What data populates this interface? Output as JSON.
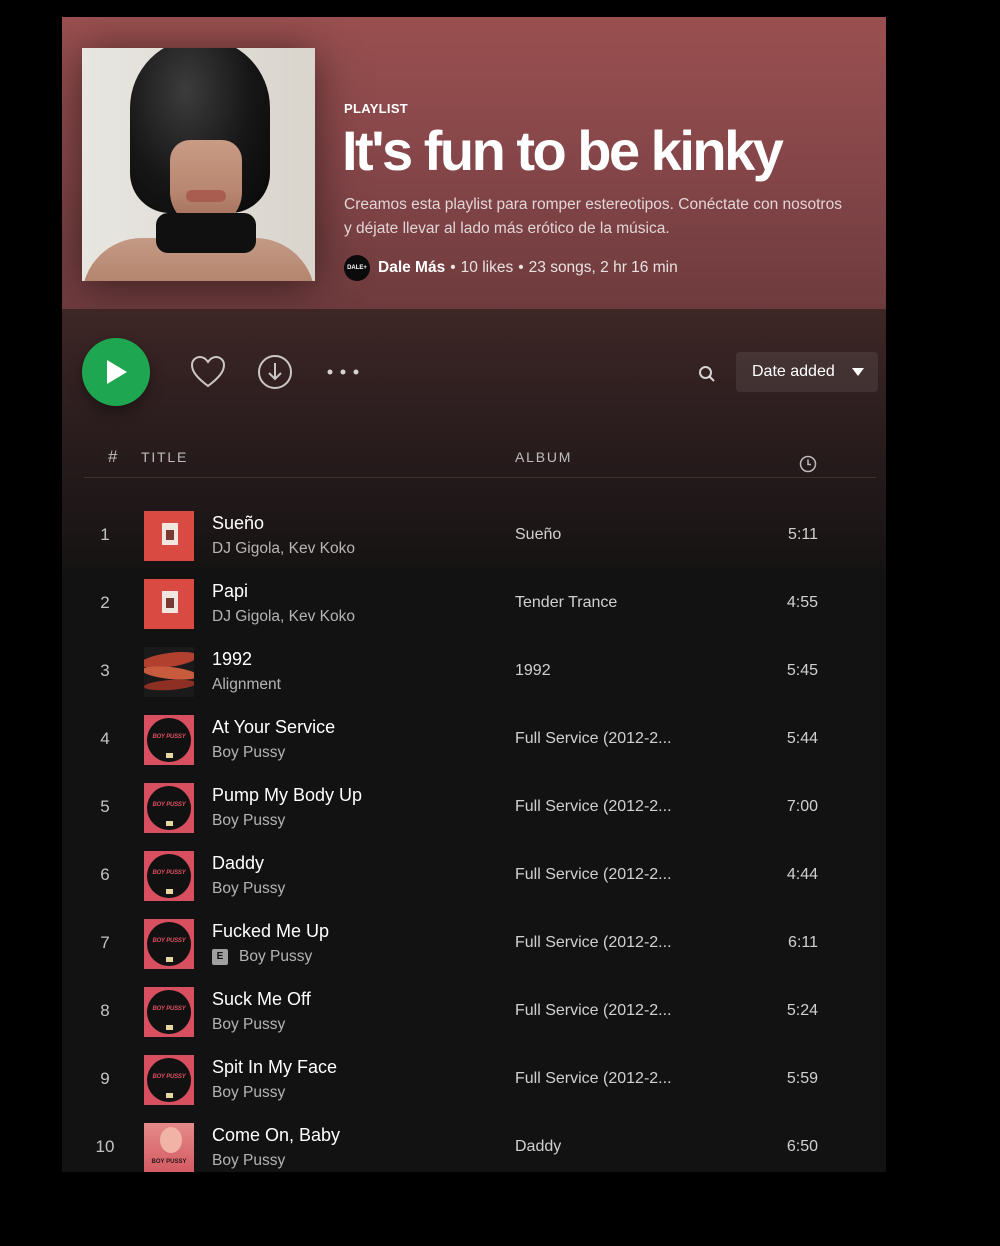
{
  "playlist": {
    "label": "PLAYLIST",
    "title": "It's fun to be kinky",
    "description": "Creamos esta playlist para romper estereotipos. Conéctate con nosotros y déjate llevar al lado más erótico de la música.",
    "owner": "Dale Más",
    "owner_avatar_text": "DALE+",
    "likes": "10 likes",
    "songs_duration": "23 songs, 2 hr 16 min",
    "separator": "•"
  },
  "controls": {
    "sort_label": "Date added",
    "icons": [
      "play-icon",
      "heart-icon",
      "download-icon",
      "more-icon",
      "search-icon",
      "caret-down-icon"
    ]
  },
  "table": {
    "headers": {
      "number": "#",
      "title": "TITLE",
      "album": "ALBUM",
      "duration_icon": "clock-icon"
    },
    "rows": [
      {
        "num": "1",
        "title": "Sueño",
        "artist": "DJ Gigola, Kev Koko",
        "album": "Sueño",
        "duration": "5:11",
        "explicit": false,
        "art": "red"
      },
      {
        "num": "2",
        "title": "Papi",
        "artist": "DJ Gigola, Kev Koko",
        "album": "Tender Trance",
        "duration": "4:55",
        "explicit": false,
        "art": "red"
      },
      {
        "num": "3",
        "title": "1992",
        "artist": "Alignment",
        "album": "1992",
        "duration": "5:45",
        "explicit": false,
        "art": "1992"
      },
      {
        "num": "4",
        "title": "At Your Service",
        "artist": "Boy Pussy",
        "album": "Full Service (2012-2...",
        "duration": "5:44",
        "explicit": false,
        "art": "bp"
      },
      {
        "num": "5",
        "title": "Pump My Body Up",
        "artist": "Boy Pussy",
        "album": "Full Service (2012-2...",
        "duration": "7:00",
        "explicit": false,
        "art": "bp"
      },
      {
        "num": "6",
        "title": "Daddy",
        "artist": "Boy Pussy",
        "album": "Full Service (2012-2...",
        "duration": "4:44",
        "explicit": false,
        "art": "bp"
      },
      {
        "num": "7",
        "title": "Fucked Me Up",
        "artist": "Boy Pussy",
        "album": "Full Service (2012-2...",
        "duration": "6:11",
        "explicit": true,
        "explicit_label": "E",
        "art": "bp"
      },
      {
        "num": "8",
        "title": "Suck Me Off",
        "artist": "Boy Pussy",
        "album": "Full Service (2012-2...",
        "duration": "5:24",
        "explicit": false,
        "art": "bp"
      },
      {
        "num": "9",
        "title": "Spit In My Face",
        "artist": "Boy Pussy",
        "album": "Full Service (2012-2...",
        "duration": "5:59",
        "explicit": false,
        "art": "bp"
      },
      {
        "num": "10",
        "title": "Come On, Baby",
        "artist": "Boy Pussy",
        "album": "Daddy",
        "duration": "6:50",
        "explicit": false,
        "art": "daddy"
      }
    ]
  },
  "album_art_text": {
    "bp": "BOY PUSSY",
    "daddy": "BOY PUSSY"
  },
  "colors": {
    "header_gradient_top": "#9a4f4f",
    "play_button": "#1ea651",
    "background": "#121212"
  }
}
